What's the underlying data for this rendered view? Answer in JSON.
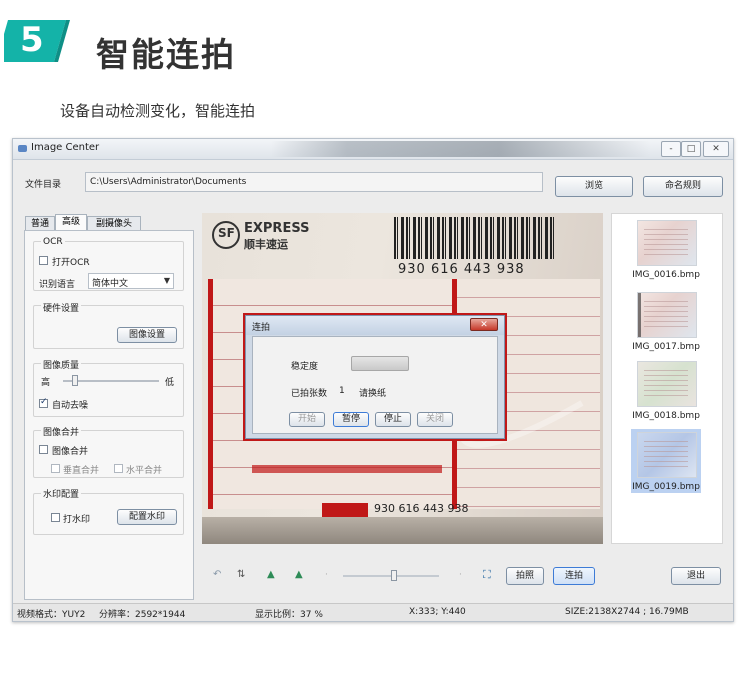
{
  "header": {
    "step_number": "5",
    "title": "智能连拍",
    "subtitle": "设备自动检测变化，智能连拍"
  },
  "window": {
    "title": "Image Center",
    "controls": [
      "-",
      "□",
      "✕"
    ],
    "file_dir_label": "文件目录",
    "file_dir_value": "C:\\Users\\Administrator\\Documents",
    "browse_label": "浏览",
    "naming_rule_label": "命名规则"
  },
  "tabs": [
    "普通",
    "高级",
    "副摄像头"
  ],
  "panel": {
    "ocr_group": "OCR",
    "open_ocr": "打开OCR",
    "lang_label": "识别语言",
    "lang_value": "简体中文",
    "hardware_group": "硬件设置",
    "image_settings_btn": "图像设置",
    "quality_group": "图像质量",
    "quality_high": "高",
    "quality_low": "低",
    "quality_level": 0.1,
    "auto_denoise": "自动去噪",
    "merge_group": "图像合并",
    "merge_image": "图像合并",
    "merge_vertical": "垂直合并",
    "merge_horizontal": "水平合并",
    "watermark_group": "水印配置",
    "watermark_check": "打水印",
    "watermark_btn": "配置水印"
  },
  "preview": {
    "brand": "EXPRESS",
    "brand_cn": "顺丰速运",
    "waybill": "930 616 443 938",
    "waybill_bottom": "930 616 443 938"
  },
  "dialog": {
    "title": "连拍",
    "stability_label": "稳定度",
    "count_label": "已拍张数",
    "count_value": "1",
    "prompt": "请换纸",
    "buttons": [
      "开始",
      "暂停",
      "停止",
      "关闭"
    ]
  },
  "thumbnails": [
    {
      "label": "IMG_0016.bmp",
      "selected": false
    },
    {
      "label": "IMG_0017.bmp",
      "selected": false
    },
    {
      "label": "IMG_0018.bmp",
      "selected": false
    },
    {
      "label": "IMG_0019.bmp",
      "selected": true
    }
  ],
  "toolbar": {
    "capture": "拍照",
    "burst": "连拍",
    "exit": "退出"
  },
  "statusbar": {
    "video_format": "视频格式：YUY2",
    "resolution": "分辨率：2592*1944",
    "scale": "显示比例：37 %",
    "coords": "X:333; Y:440",
    "size": "SIZE:2138X2744 ; 16.79MB"
  },
  "colors": {
    "badge": "#14b3a8",
    "accent_red": "#c01818",
    "selection_blue": "#3d7bd6"
  }
}
